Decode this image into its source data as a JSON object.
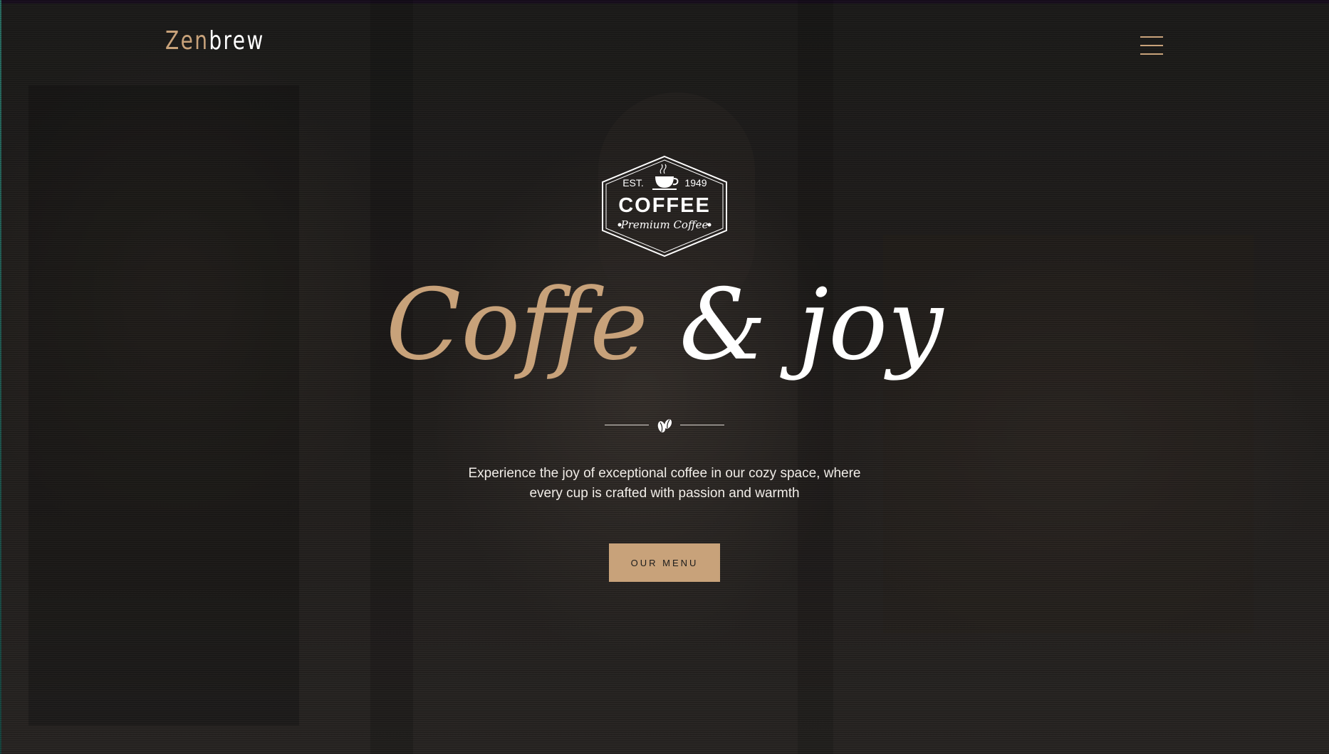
{
  "header": {
    "logo_part1": "Zen",
    "logo_part2": "brew",
    "menu_icon": "hamburger-icon"
  },
  "badge": {
    "est_label": "EST.",
    "year": "1949",
    "title": "COFFEE",
    "subtitle": "Premium Coffee",
    "icon": "coffee-cup-icon"
  },
  "hero": {
    "headline_part1": "Coffe",
    "headline_part2": "& joy",
    "divider_icon": "coffee-bean-icon",
    "description_line1": "Experience the joy of exceptional coffee in our cozy space, where",
    "description_line2": "every cup is crafted with passion and warmth",
    "cta_label": "OUR MENU"
  },
  "colors": {
    "accent": "#c8a27a",
    "background": "#1e1d1c",
    "text": "#ffffff"
  }
}
